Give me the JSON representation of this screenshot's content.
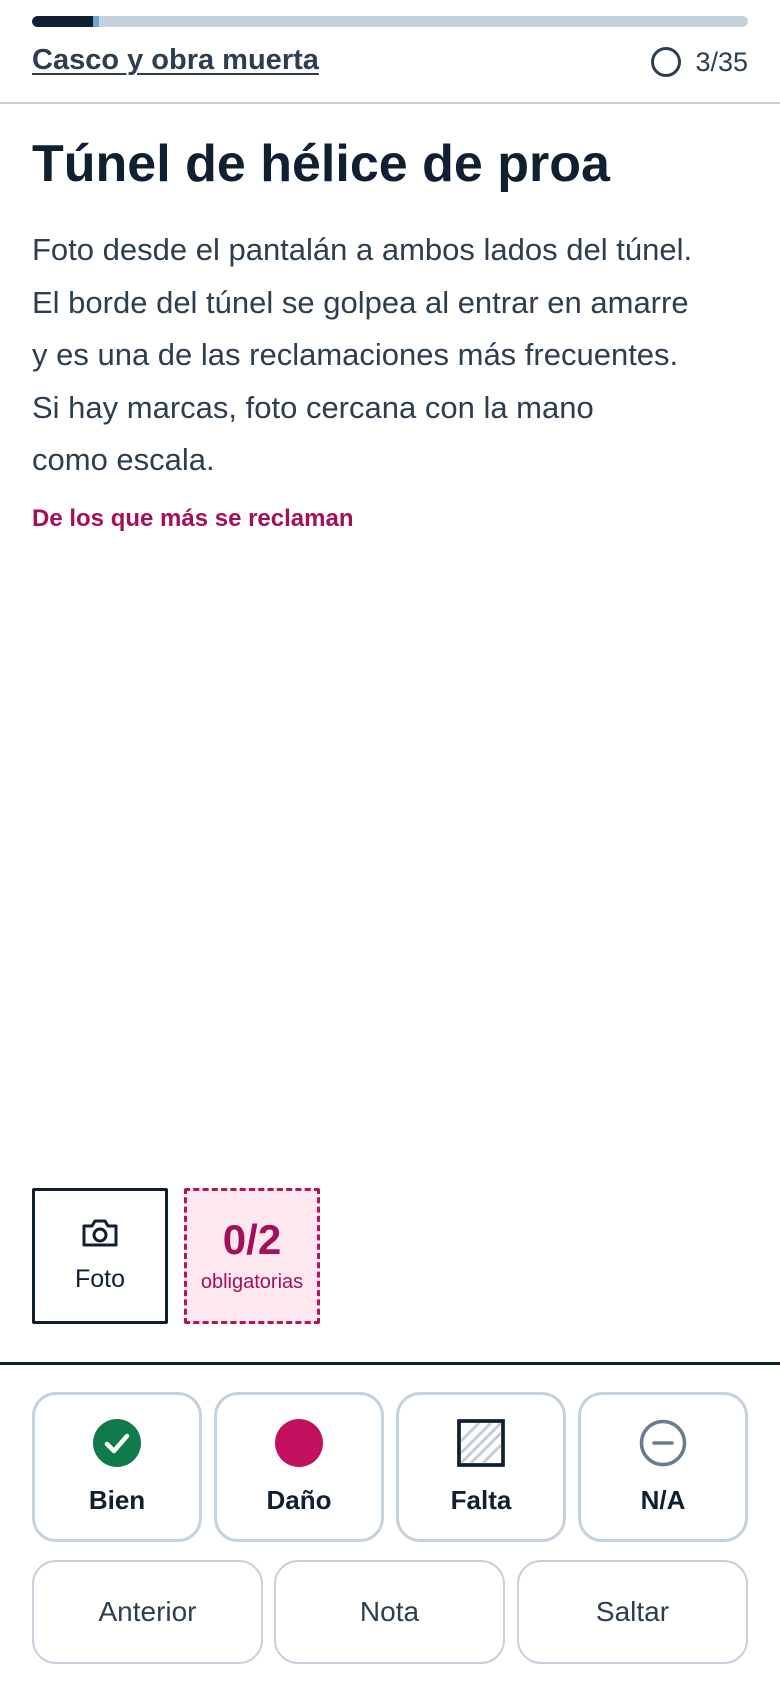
{
  "progress": {
    "current": 3,
    "total": 35,
    "fill_color": "#102032",
    "track_color": "#c5d1dc"
  },
  "header": {
    "section_link": "Casco y obra muerta",
    "counter": "3/35"
  },
  "item": {
    "title": "Túnel de hélice de proa",
    "description_lines": [
      "Foto desde el pantalán a ambos lados del túnel.",
      "El borde del túnel se golpea al entrar en amarre",
      "y es una de las reclamaciones más frecuentes.",
      "Si hay marcas, foto cercana con la mano",
      "como escala."
    ],
    "flag_note": "De los que más se reclaman",
    "flag_color": "#a3105a"
  },
  "photos": {
    "photo_button_label": "Foto",
    "required_count": "0/2",
    "required_label": "obligatorias"
  },
  "status_options": [
    {
      "label": "Bien",
      "icon": "check-circle-icon",
      "color": "#0f7a4a"
    },
    {
      "label": "Daño",
      "icon": "filled-dot-icon",
      "color": "#c0105e"
    },
    {
      "label": "Falta",
      "icon": "hatched-square-icon",
      "color": "#102032"
    },
    {
      "label": "N/A",
      "icon": "minus-circle-icon",
      "color": "#6b7c8c"
    }
  ],
  "navigation": {
    "previous": "Anterior",
    "note": "Nota",
    "skip": "Saltar"
  }
}
